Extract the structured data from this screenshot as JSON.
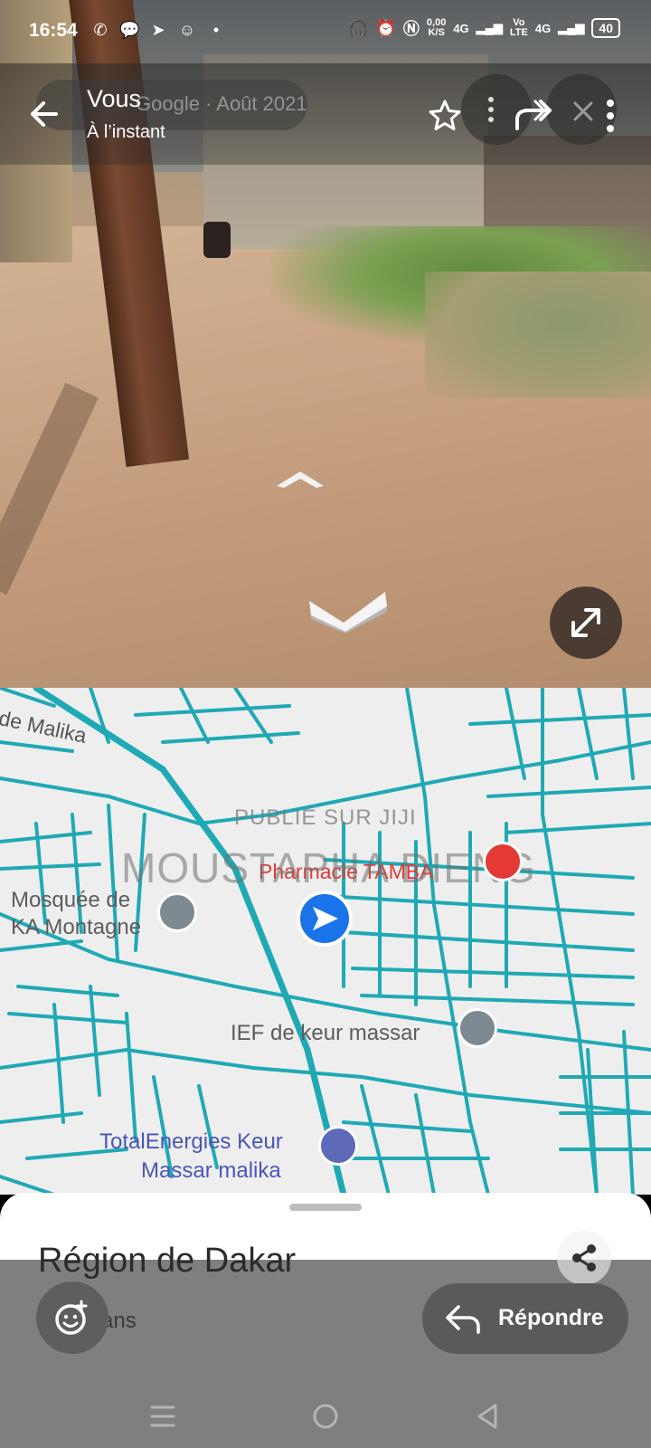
{
  "status_bar": {
    "time": "16:54",
    "data_rate": "0,00",
    "data_unit": "K/S",
    "network_1": "4G",
    "volte_top": "Vo",
    "volte_bottom": "LTE",
    "network_2": "4G",
    "battery": "40"
  },
  "street_view": {
    "user_name": "Vous",
    "posted": "À l’instant",
    "imagery_caption": "Google · Août 2021"
  },
  "map": {
    "label_malika": "de Malika",
    "mosque_line1": "Mosquée de",
    "mosque_line2": "KA Montagne",
    "pharmacie": "Pharmacie TAMBA",
    "ief": "IEF de keur massar",
    "total_line1": "TotalEnergies Keur",
    "total_line2": "Massar malika",
    "watermark_top": "PUBLIÉ SUR JIJI",
    "watermark_name": "MOUSTAPHA DIENG"
  },
  "sheet": {
    "title": "Région de Dakar",
    "subtitle": "4 ans"
  },
  "footer": {
    "reply_label": "Répondre"
  },
  "colors": {
    "road": "#1fa9b5",
    "accent_blue": "#1a73e8",
    "pharmacy_red": "#e53935"
  }
}
